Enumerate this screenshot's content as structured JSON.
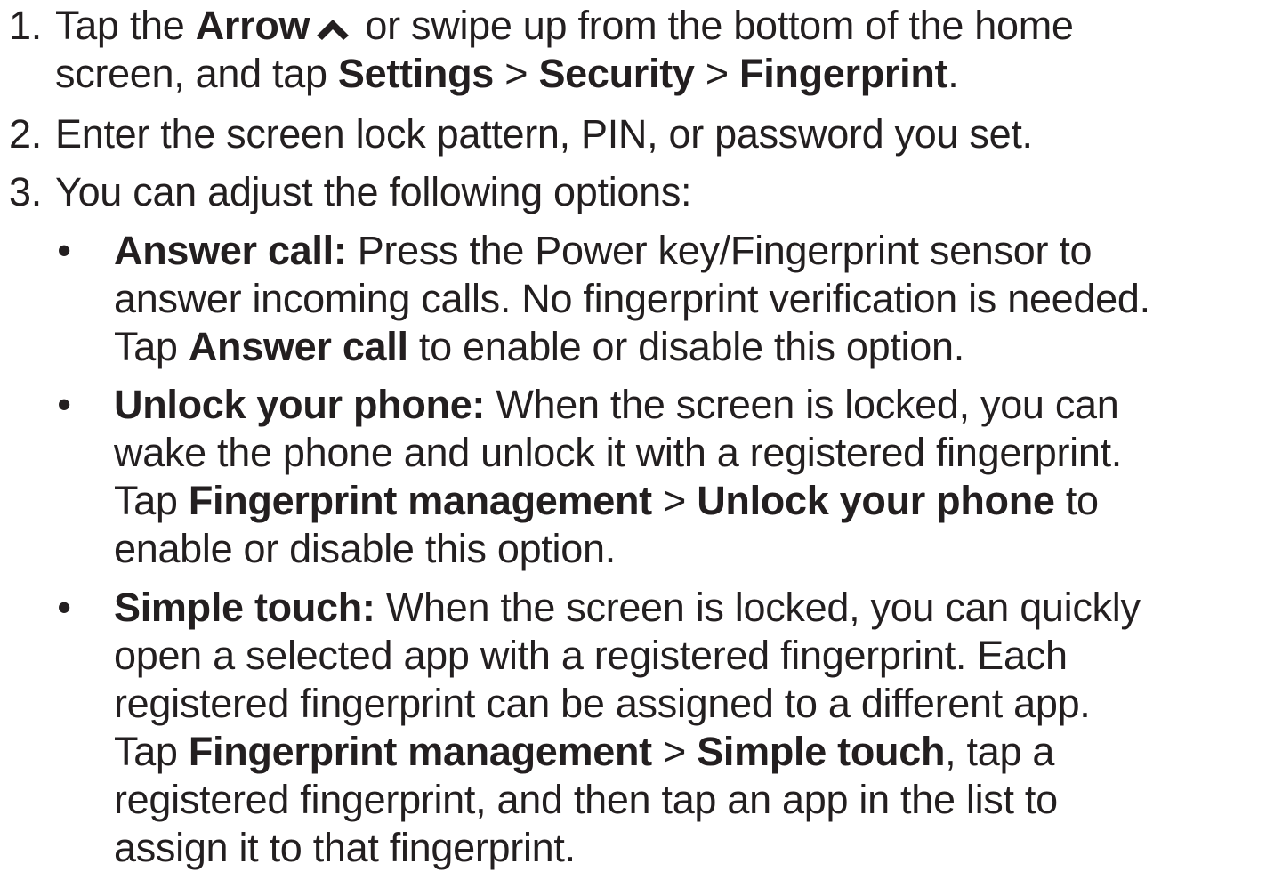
{
  "steps": [
    {
      "number": "1.",
      "lines": {
        "l1_pre": "Tap the ",
        "l1_bold_arrow": "Arrow",
        "l1_post": " or swipe up from the bottom of the home",
        "l2_pre": "screen, and tap ",
        "settings": "Settings",
        "sep1": " > ",
        "security": "Security",
        "sep2": " > ",
        "fingerprint": "Fingerprint",
        "end": "."
      },
      "icon": "arrow-up-icon"
    },
    {
      "number": "2.",
      "text": "Enter the screen lock pattern, PIN, or password you set."
    },
    {
      "number": "3.",
      "text": "You can adjust the following options:"
    }
  ],
  "options": [
    {
      "bullet": "•",
      "title": "Answer call:",
      "l1": " Press the Power key/Fingerprint sensor to",
      "l2": "answer incoming calls. No fingerprint verification is needed.",
      "l3_pre": "Tap ",
      "l3_bold": "Answer call",
      "l3_post": " to enable or disable this option."
    },
    {
      "bullet": "•",
      "title": "Unlock your phone:",
      "l1": " When the screen is locked, you can",
      "l2": "wake the phone and unlock it with a registered fingerprint.",
      "l3_pre": "Tap ",
      "l3_bold1": "Fingerprint management",
      "l3_sep": " > ",
      "l3_bold2": "Unlock your phone",
      "l3_post": " to",
      "l4": "enable or disable this option."
    },
    {
      "bullet": "•",
      "title": "Simple touch:",
      "l1": " When the screen is locked, you can quickly",
      "l2": "open a selected app with a registered fingerprint. Each",
      "l3": "registered fingerprint can be assigned to a different app.",
      "l4_pre": "Tap ",
      "l4_bold1": "Fingerprint management",
      "l4_sep": " > ",
      "l4_bold2": "Simple touch",
      "l4_post": ", tap a",
      "l5": "registered fingerprint, and then tap an app in the list to",
      "l6": "assign it to that fingerprint."
    }
  ]
}
